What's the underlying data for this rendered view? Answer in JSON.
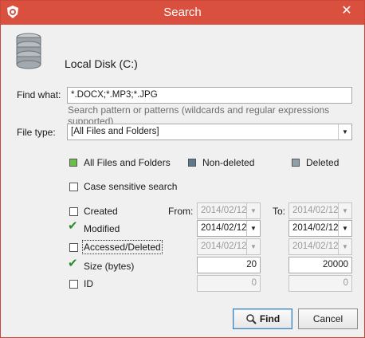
{
  "window": {
    "title": "Search",
    "close_label": "✕"
  },
  "disk": {
    "label": "Local Disk (C:)"
  },
  "find_what": {
    "label": "Find what:",
    "value": "*.DOCX;*.MP3;*.JPG",
    "hint": "Search pattern or patterns (wildcards and regular expressions supported)"
  },
  "file_type": {
    "label": "File type:",
    "selected": "[All Files and Folders]"
  },
  "legend": {
    "all": "All Files and Folders",
    "non_deleted": "Non-deleted",
    "deleted": "Deleted",
    "colors": {
      "all": "#6abf4b",
      "non_deleted": "#5d7a8c",
      "deleted": "#8fa0a8"
    }
  },
  "case_sensitive": {
    "label": "Case sensitive search",
    "checked": false
  },
  "from_label": "From:",
  "to_label": "To:",
  "filters": {
    "created": {
      "label": "Created",
      "checked": false,
      "from": "2014/02/12",
      "to": "2014/02/12"
    },
    "modified": {
      "label": "Modified",
      "checked": true,
      "from": "2014/02/12",
      "to": "2014/02/12"
    },
    "accessed": {
      "label": "Accessed/Deleted",
      "checked": false,
      "from": "2014/02/12",
      "to": "2014/02/12"
    },
    "size": {
      "label": "Size (bytes)",
      "checked": true,
      "from": "20",
      "to": "20000"
    },
    "id": {
      "label": "ID",
      "checked": false,
      "from": "0",
      "to": "0"
    }
  },
  "buttons": {
    "find": "Find",
    "cancel": "Cancel"
  }
}
